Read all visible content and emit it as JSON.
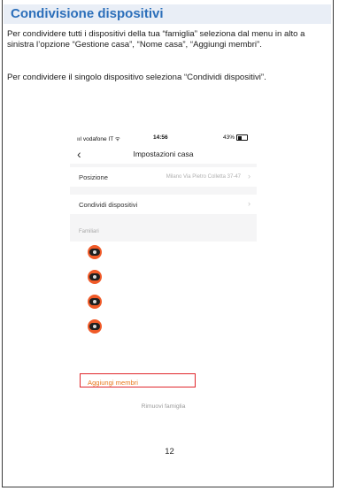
{
  "document": {
    "title": "Condivisione dispositivi",
    "paragraph_1": "Per condividere tutti i dispositivi della tua “famiglia” seleziona dal menu in alto a sinistra l’opzione “Gestione casa”, “Nome casa”, “Aggiungi membri”.",
    "paragraph_2": "Per condividere il singolo dispositivo seleziona “Condividi dispositivi”.",
    "page_number": "12"
  },
  "phone": {
    "status": {
      "carrier": "vodafone IT",
      "time": "14:56",
      "battery": "43%"
    },
    "nav": {
      "back": "‹",
      "title": "Impostazioni casa"
    },
    "location_row": {
      "label": "Posizione",
      "value": "Milano Via Pietro Colletta 37-47",
      "chevron": "›"
    },
    "share_row": {
      "label": "Condividi dispositivi",
      "chevron": "›"
    },
    "members_group_label": "Familiari",
    "members": [
      {
        "icon": "robot-avatar-icon"
      },
      {
        "icon": "robot-avatar-icon"
      },
      {
        "icon": "robot-avatar-icon"
      },
      {
        "icon": "robot-avatar-icon"
      }
    ],
    "add_members_label": "Aggiungi membri",
    "remove_family_label": "Rimuovi famiglia",
    "colors": {
      "accent": "#e8791e",
      "highlight": "#e0262b",
      "title": "#2c6fba"
    }
  }
}
